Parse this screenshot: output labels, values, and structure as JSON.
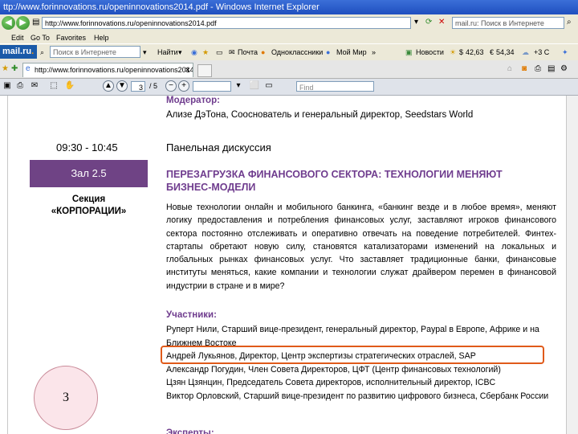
{
  "window": {
    "title": "ttp://www.forinnovations.ru/openinnovations2014.pdf - Windows Internet Explorer"
  },
  "address_bar": {
    "url": "http://www.forinnovations.ru/openinnovations2014.pdf",
    "search_value": "mail.ru: Поиск в Интернете"
  },
  "menu": {
    "items": [
      "Edit",
      "Go To",
      "Favorites",
      "Help"
    ]
  },
  "toolbar": {
    "brand": "mail.ru",
    "brand_dot": ".",
    "search_placeholder": "Поиск в Интернете",
    "find_label": "Найти",
    "mail_label": "Почта",
    "classmates_label": "Одноклассники",
    "myworld_label": "Мой Мир",
    "more_label": "»",
    "news_label": "Новости",
    "usd_rate": "42,63",
    "eur_rate": "54,34",
    "weather": "+3 С"
  },
  "tabs": [
    {
      "label": "http://www.forinnovations.ru/openinnovations2014.pdf"
    }
  ],
  "pdf_toolbar": {
    "page_current": "3",
    "page_total": "/ 5",
    "zoom": "",
    "find_placeholder": "Find"
  },
  "document": {
    "moderator_label": "Модератор:",
    "moderator_text": "Ализе ДэТона, Сооснователь и генеральный директор, Seedstars World",
    "time": "09:30 - 10:45",
    "panel_title": "Панельная дискуссия",
    "hall": "Зал 2.5",
    "section_line1": "Секция",
    "section_line2": "«КОРПОРАЦИИ»",
    "session_title": "ПЕРЕЗАГРУЗКА ФИНАНСОВОГО СЕКТОРА: ТЕХНОЛОГИИ МЕНЯЮТ БИЗНЕС-МОДЕЛИ",
    "description": "Новые технологии онлайн и мобильного банкинга, «банкинг везде и в любое время», меняют логику предоставления и потребления финансовых услуг, заставляют игроков финансового сектора постоянно отслеживать и оперативно отвечать на поведение потребителей. Финтех-стартапы обретают новую силу, становятся катализаторами изменений на локальных и глобальных рынках финансовых услуг. Что заставляет традиционные банки, финансовые институты меняться, какие компании и технологии служат драйвером перемен в финансовой индустрии в стране и в мире?",
    "participants_label": "Участники:",
    "participants": [
      "Руперт Нили, Старший вице-президент, генеральный директор, Paypal в Европе, Африке и на Ближнем Востоке",
      "Андрей Лукьянов, Директор, Центр экспертизы стратегических отраслей, SAP",
      "Александр Погудин, Член Совета Директоров, ЦФТ (Центр финансовых технологий)",
      "Цзян Цзянцин, Председатель Совета директоров, исполнительный директор, ICBC",
      "Виктор Орловский, Старший вице-президент по развитию цифрового бизнеса, Сбербанк России"
    ],
    "experts_label": "Эксперты:"
  },
  "slide_number": "3",
  "colors": {
    "accent_purple": "#6f3c8e",
    "hall_box": "#6f4385",
    "highlight": "#e05a1a",
    "badge_fill": "#fbe5ea"
  }
}
